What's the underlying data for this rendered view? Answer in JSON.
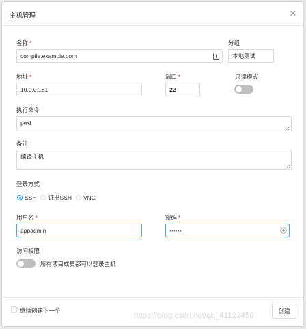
{
  "dialog": {
    "title": "主机管理",
    "close_icon": "close-icon"
  },
  "form": {
    "name_label": "名称",
    "name_value": "compile.example.com",
    "group_label": "分组",
    "group_value": "本地测试",
    "address_label": "地址",
    "address_value": "10.0.0.181",
    "port_label": "端口",
    "port_value": "22",
    "readonly_label": "只读模式",
    "readonly_enabled": false,
    "command_label": "执行命令",
    "command_value": "pwd",
    "remark_label": "备注",
    "remark_value": "编译主机",
    "login_label": "登录方式",
    "login_options": [
      "SSH",
      "证书SSH",
      "VNC"
    ],
    "login_selected": "SSH",
    "username_label": "用户名",
    "username_value": "appadmin",
    "password_label": "密码",
    "password_value": "••••••",
    "access_label": "访问权限",
    "access_switch_text": "所有项目成员都可以登录主机",
    "access_enabled": false,
    "required_mark": "*"
  },
  "footer": {
    "continue_label": "继续创建下一个",
    "create_button": "创建"
  },
  "watermark": "https://blog.csdn.net/qq_41123456",
  "colors": {
    "primary": "#1890ff",
    "required": "#f5222d",
    "border": "#d9d9d9"
  }
}
